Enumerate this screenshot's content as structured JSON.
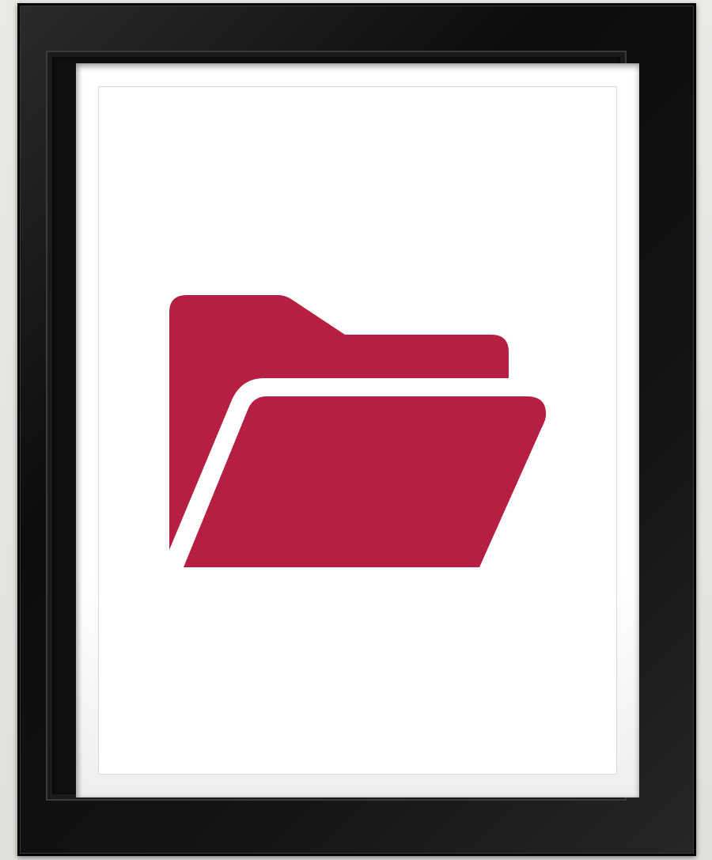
{
  "scene": {
    "subject": "folder-icon",
    "colors": {
      "icon": "#b71f42",
      "frame": "#111111",
      "mat": "#ffffff",
      "wall": "#e6e4e1"
    }
  }
}
